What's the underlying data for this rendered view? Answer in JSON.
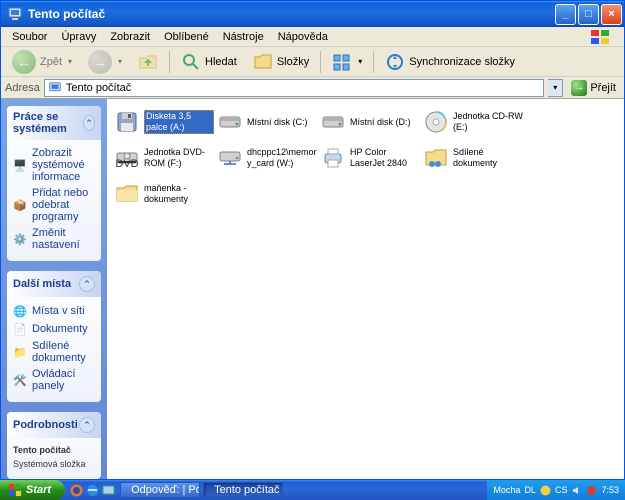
{
  "titlebar": {
    "title": "Tento počítač"
  },
  "menubar": {
    "items": [
      "Soubor",
      "Úpravy",
      "Zobrazit",
      "Oblíbené",
      "Nástroje",
      "Nápověda"
    ]
  },
  "toolbar": {
    "back": "Zpět",
    "search": "Hledat",
    "folders": "Složky",
    "sync": "Synchronizace složky"
  },
  "addressbar": {
    "label": "Adresa",
    "value": "Tento počítač",
    "go": "Přejít"
  },
  "sidebar": {
    "panels": [
      {
        "title": "Práce se systémem",
        "tasks": [
          "Zobrazit systémové informace",
          "Přidat nebo odebrat programy",
          "Změnit nastavení"
        ]
      },
      {
        "title": "Další místa",
        "tasks": [
          "Místa v síti",
          "Dokumenty",
          "Sdílené dokumenty",
          "Ovládací panely"
        ]
      },
      {
        "title": "Podrobnosti",
        "details": [
          "Tento počítač",
          "Systémová složka"
        ]
      }
    ]
  },
  "items": [
    {
      "label": "Disketa 3,5 palce (A:)",
      "icon": "floppy",
      "selected": true
    },
    {
      "label": "Místní disk (C:)",
      "icon": "hdd"
    },
    {
      "label": "Místní disk (D:)",
      "icon": "hdd"
    },
    {
      "label": "Jednotka CD-RW (E:)",
      "icon": "cdrw"
    },
    {
      "label": "Jednotka DVD-ROM (F:)",
      "icon": "dvd"
    },
    {
      "label": "dhcppc12\\memory_card (W:)",
      "icon": "netdrive"
    },
    {
      "label": "HP Color LaserJet 2840",
      "icon": "printer"
    },
    {
      "label": "Sdílené dokumenty",
      "icon": "folder-shared"
    },
    {
      "label": "maňenka - dokumenty",
      "icon": "folder"
    }
  ],
  "taskbar": {
    "start": "Start",
    "tasks": [
      {
        "label": "Odpověď: | Poradte.c...",
        "active": false
      },
      {
        "label": "Tento počítač",
        "active": true
      }
    ],
    "tray": {
      "status": "Mocha",
      "zoom": "DL",
      "lang": "CS",
      "time": "7:53"
    }
  }
}
